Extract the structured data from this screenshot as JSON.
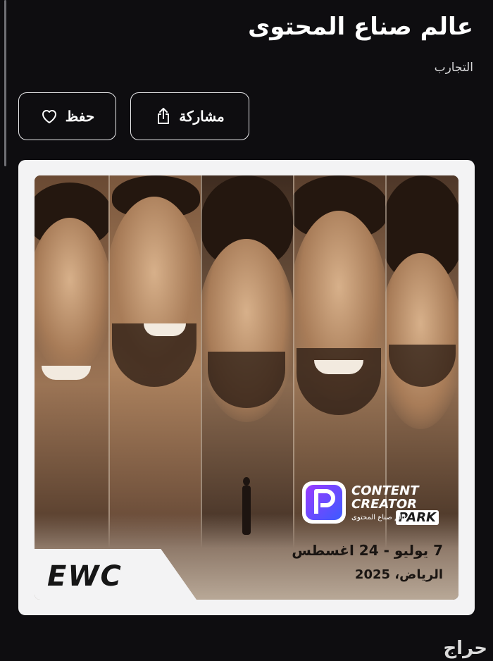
{
  "listing": {
    "title": "عالم صناع المحتوى",
    "category": "التجارب"
  },
  "actions": {
    "share_label": "مشاركة",
    "save_label": "حفظ",
    "share_icon": "share-icon",
    "save_icon": "heart-icon"
  },
  "poster": {
    "brand_line1": "CONTENT",
    "brand_line2": "CREATOR",
    "brand_line3": "PARK",
    "brand_arabic": "عالم صناع المحتوى",
    "dates": "7 يوليو - 24 اغسطس",
    "location": "الرياض، 2025",
    "event_logo": "EWC"
  },
  "watermark": "حراج",
  "colors": {
    "background": "#0e0d10",
    "card": "#f3f3f4",
    "accent_blue": "#3b5bff",
    "accent_purple": "#9b3bff"
  }
}
